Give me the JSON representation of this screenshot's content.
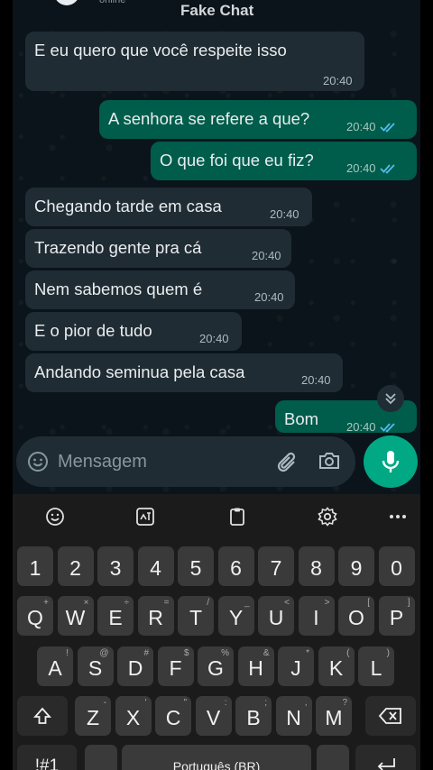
{
  "header": {
    "title": "Fake Chat",
    "subtitle": "online"
  },
  "messages": [
    {
      "dir": "in",
      "text": "E eu quero que você respeite isso",
      "time": "20:40"
    },
    {
      "dir": "out",
      "text": "A senhora se refere a que?",
      "time": "20:40",
      "status": "read"
    },
    {
      "dir": "out",
      "text": "O que foi que eu fiz?",
      "time": "20:40",
      "status": "read"
    },
    {
      "dir": "in",
      "text": "Chegando tarde em casa",
      "time": "20:40"
    },
    {
      "dir": "in",
      "text": "Trazendo gente pra cá",
      "time": "20:40"
    },
    {
      "dir": "in",
      "text": "Nem sabemos quem é",
      "time": "20:40"
    },
    {
      "dir": "in",
      "text": "E o pior de tudo",
      "time": "20:40"
    },
    {
      "dir": "in",
      "text": "Andando seminua pela casa",
      "time": "20:40"
    },
    {
      "dir": "out",
      "text": "Bom",
      "time": "20:40",
      "status": "read"
    }
  ],
  "composer": {
    "placeholder": "Mensagem"
  },
  "colors": {
    "incoming": "#202c33",
    "outgoing": "#005c4b",
    "accent": "#00a884",
    "read_ticks": "#53bdeb"
  },
  "keyboard": {
    "toolbar": [
      "emoji-icon",
      "sticker-icon",
      "clipboard-icon",
      "settings-icon",
      "more-icon"
    ],
    "numbers": [
      "1",
      "2",
      "3",
      "4",
      "5",
      "6",
      "7",
      "8",
      "9",
      "0"
    ],
    "row1": [
      [
        "Q",
        "+"
      ],
      [
        "W",
        "×"
      ],
      [
        "E",
        "÷"
      ],
      [
        "R",
        "="
      ],
      [
        "T",
        "/"
      ],
      [
        "Y",
        "_"
      ],
      [
        "U",
        "<"
      ],
      [
        "I",
        ">"
      ],
      [
        "O",
        "["
      ],
      [
        "P",
        "]"
      ]
    ],
    "row2": [
      [
        "A",
        "!"
      ],
      [
        "S",
        "@"
      ],
      [
        "D",
        "#"
      ],
      [
        "F",
        "$"
      ],
      [
        "G",
        "%"
      ],
      [
        "H",
        "&"
      ],
      [
        "J",
        "*"
      ],
      [
        "K",
        "("
      ],
      [
        "L",
        ")"
      ]
    ],
    "row3": [
      [
        "Z",
        "-"
      ],
      [
        "X",
        "'"
      ],
      [
        "C",
        "\""
      ],
      [
        "V",
        ":"
      ],
      [
        "B",
        ";"
      ],
      [
        "N",
        ","
      ],
      [
        "M",
        "?"
      ]
    ],
    "symbols_label": "!#1",
    "space_label": "Português (BR)"
  }
}
